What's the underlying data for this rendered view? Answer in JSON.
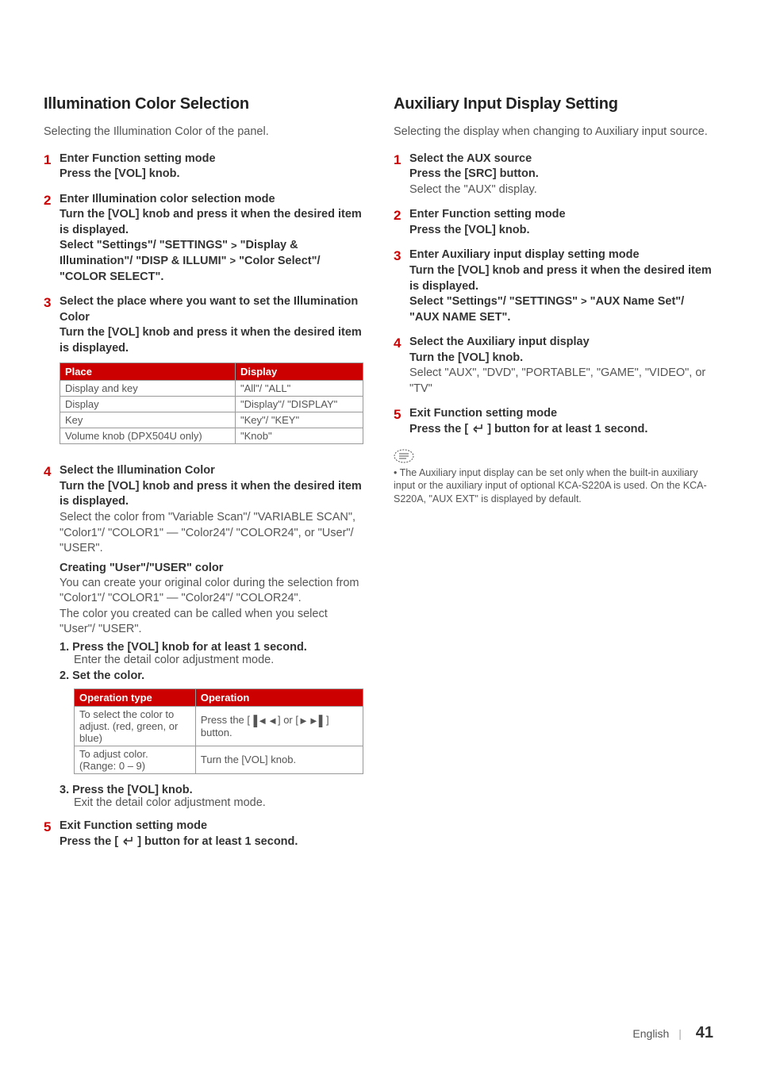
{
  "left": {
    "heading": "Illumination Color Selection",
    "intro": "Selecting the Illumination Color of the panel.",
    "step1": {
      "title": "Enter Function setting mode",
      "action": "Press the [VOL] knob."
    },
    "step2": {
      "title": "Enter Illumination color selection mode",
      "action": "Turn the [VOL] knob and press it when the desired item is displayed.",
      "path1a": "Select \"Settings\"/ \"SETTINGS\" ",
      "path1b": " \"Display & Illumination\"/ \"DISP & ILLUMI\" ",
      "path1c": " \"Color Select\"/ \"COLOR SELECT\"."
    },
    "step3": {
      "title": "Select the place where you want to set the Illumination Color",
      "action": "Turn the [VOL] knob and press it when the desired item is displayed.",
      "table": {
        "h1": "Place",
        "h2": "Display",
        "r1c1": "Display and key",
        "r1c2": "\"All\"/ \"ALL\"",
        "r2c1": "Display",
        "r2c2": "\"Display\"/ \"DISPLAY\"",
        "r3c1": "Key",
        "r3c2": "\"Key\"/ \"KEY\"",
        "r4c1": "Volume knob (DPX504U only)",
        "r4c2": "\"Knob\""
      }
    },
    "step4": {
      "title": "Select the Illumination Color",
      "action": "Turn the [VOL] knob and press it when the desired item is displayed.",
      "text": "Select the color from \"Variable Scan\"/ \"VARIABLE SCAN\", \"Color1\"/ \"COLOR1\" — \"Color24\"/ \"COLOR24\", or \"User\"/ \"USER\".",
      "subhead": "Creating \"User\"/\"USER\" color",
      "subtext1": "You can create your original color during the selection from \"Color1\"/ \"COLOR1\" — \"Color24\"/ \"COLOR24\".",
      "subtext2": "The color you created can be called when you select \"User\"/ \"USER\".",
      "s1t": "Press the [VOL] knob for at least 1 second.",
      "s1d": "Enter the detail color adjustment mode.",
      "s2t": "Set the color.",
      "table2": {
        "h1": "Operation type",
        "h2": "Operation",
        "r1c1": "To select the color to adjust. (red, green, or blue)",
        "r1c2a": "Press the [",
        "r1c2b": "] or [",
        "r1c2c": "] button.",
        "r2c1": "To adjust color.\n(Range: 0 – 9)",
        "r2c2": "Turn the [VOL] knob."
      },
      "s3t": "Press the [VOL] knob.",
      "s3d": "Exit the detail color adjustment mode."
    },
    "step5": {
      "title": "Exit Function setting mode",
      "action_a": "Press the [ ",
      "action_b": " ] button for at least 1 second."
    }
  },
  "right": {
    "heading": "Auxiliary Input Display Setting",
    "intro": "Selecting the display when changing to Auxiliary input source.",
    "step1": {
      "title": "Select the AUX source",
      "action": "Press the [SRC] button.",
      "text": "Select the \"AUX\" display."
    },
    "step2": {
      "title": "Enter Function setting mode",
      "action": "Press the [VOL] knob."
    },
    "step3": {
      "title": "Enter Auxiliary input display setting mode",
      "action": "Turn the [VOL] knob and press it when the desired item is displayed.",
      "path_a": "Select \"Settings\"/ \"SETTINGS\" ",
      "path_b": " \"AUX Name Set\"/ \"AUX NAME SET\"."
    },
    "step4": {
      "title": "Select the Auxiliary input display",
      "action": "Turn the [VOL] knob.",
      "text": "Select \"AUX\", \"DVD\", \"PORTABLE\", \"GAME\", \"VIDEO\", or \"TV\""
    },
    "step5": {
      "title": "Exit Function setting mode",
      "action_a": "Press the [ ",
      "action_b": " ] button for at least 1 second."
    },
    "note": "The Auxiliary input display can be set only when the built-in auxiliary input or the auxiliary input of optional KCA-S220A is used. On the KCA-S220A, \"AUX EXT\" is displayed by default."
  },
  "footer": {
    "lang": "English",
    "page": "41"
  }
}
